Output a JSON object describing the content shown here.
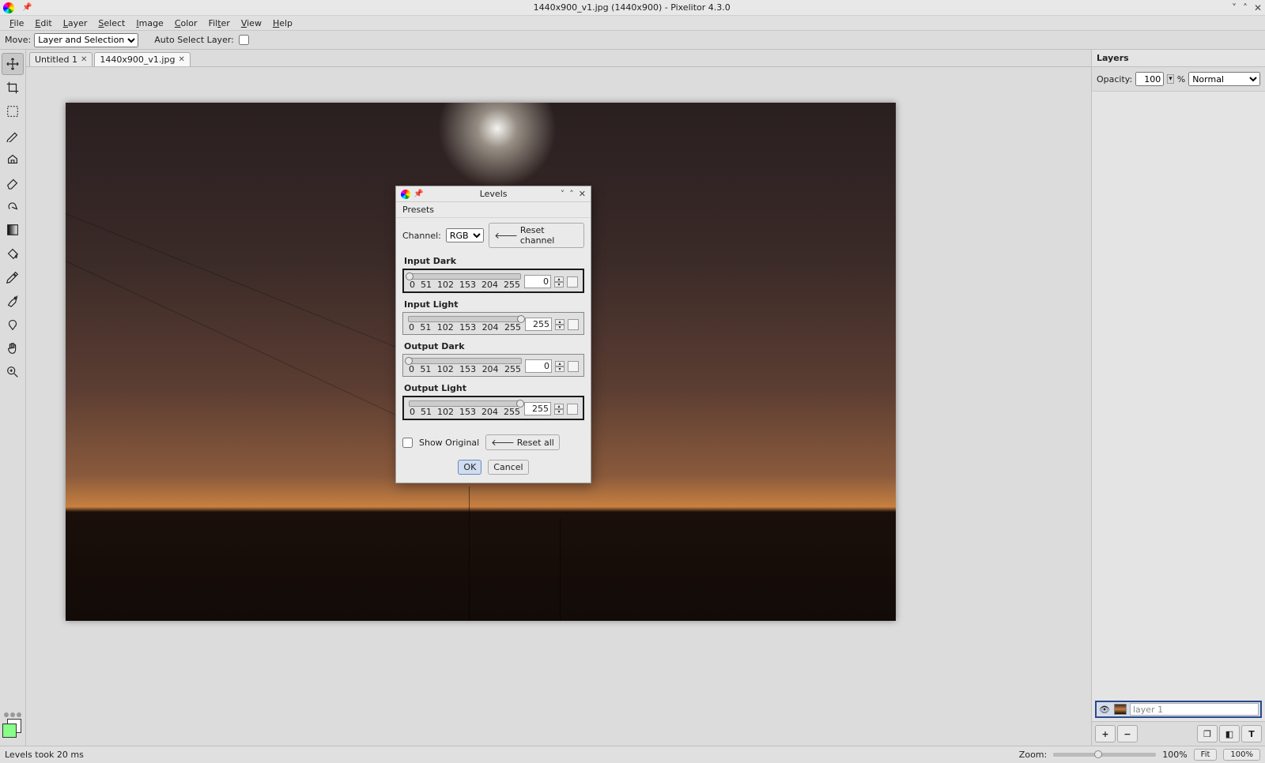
{
  "titlebar": {
    "title": "1440x900_v1.jpg (1440x900) - Pixelitor 4.3.0"
  },
  "menubar": {
    "items": [
      "File",
      "Edit",
      "Layer",
      "Select",
      "Image",
      "Color",
      "Filter",
      "View",
      "Help"
    ]
  },
  "optionbar": {
    "move_label": "Move:",
    "move_value": "Layer and Selection",
    "auto_select_label": "Auto Select Layer:"
  },
  "tabs": [
    {
      "label": "Untitled 1",
      "active": false
    },
    {
      "label": "1440x900_v1.jpg",
      "active": true
    }
  ],
  "layers_panel": {
    "header": "Layers",
    "opacity_label": "Opacity:",
    "opacity_value": "100",
    "opacity_suffix": "%",
    "blend_mode": "Normal",
    "layer_name": "layer 1",
    "btn_add": "+",
    "btn_del": "−",
    "btn_dup": "❐",
    "btn_mask": "◧",
    "btn_text": "T"
  },
  "statusbar": {
    "text": "Levels took 20 ms",
    "zoom_label": "Zoom:",
    "zoom_pct": "100%",
    "fit_label": "Fit",
    "hundred_label": "100%"
  },
  "dialog": {
    "title": "Levels",
    "presets_menu": "Presets",
    "channel_label": "Channel:",
    "channel_value": "RGB",
    "reset_channel": "Reset channel",
    "sliders": [
      {
        "label": "Input Dark",
        "value": "0",
        "pos": 0,
        "focused": true
      },
      {
        "label": "Input Light",
        "value": "255",
        "pos": 100,
        "focused": false
      },
      {
        "label": "Output Dark",
        "value": "0",
        "pos": 0,
        "focused": false
      },
      {
        "label": "Output Light",
        "value": "255",
        "pos": 100,
        "focused": true
      }
    ],
    "ticks": [
      "0",
      "51",
      "102",
      "153",
      "204",
      "255"
    ],
    "show_original": "Show Original",
    "reset_all": "Reset all",
    "ok": "OK",
    "cancel": "Cancel"
  },
  "tool_icons": [
    "move",
    "crop",
    "rect-select",
    "brush",
    "clone",
    "smudge",
    "eraser",
    "gradient",
    "bucket",
    "picker",
    "pen",
    "shapes",
    "hand",
    "zoom"
  ]
}
